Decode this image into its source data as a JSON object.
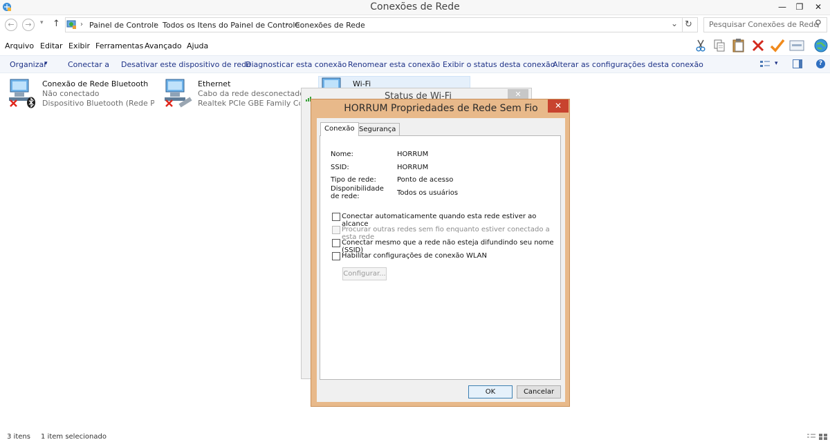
{
  "window": {
    "title": "Conexões de Rede",
    "minimize_glyph": "—",
    "restore_glyph": "❐",
    "close_glyph": "✕"
  },
  "address": {
    "back_glyph": "←",
    "forward_glyph": "→",
    "recent_glyph": "▾",
    "up_glyph": "↑",
    "breadcrumb": [
      "Painel de Controle",
      "Todos os Itens do Painel de Controle",
      "Conexões de Rede"
    ],
    "separator": "›",
    "dropdown_glyph": "⌄",
    "refresh_glyph": "↻",
    "search_placeholder": "Pesquisar Conexões de Rede",
    "search_glyph": "⚲"
  },
  "menu": [
    "Arquivo",
    "Editar",
    "Exibir",
    "Ferramentas",
    "Avançado",
    "Ajuda"
  ],
  "toolbar_icons": [
    "scissors-icon",
    "copy-icon",
    "paste-icon",
    "delete-icon",
    "checkmark-icon",
    "properties-icon",
    "globe-icon"
  ],
  "commands": {
    "organize": "Organizar",
    "organize_arrow": "▾",
    "items": [
      "Conectar a",
      "Desativar este dispositivo de rede",
      "Diagnosticar esta conexão",
      "Renomear esta conexão",
      "Exibir o status desta conexão",
      "Alterar as configurações desta conexão"
    ],
    "view_arrow": "▾",
    "help_glyph": "?"
  },
  "connections": [
    {
      "name": "Conexão de Rede Bluetooth",
      "status": "Não conectado",
      "device": "Dispositivo Bluetooth (Rede Pess..."
    },
    {
      "name": "Ethernet",
      "status": "Cabo da rede desconectado",
      "device": "Realtek PCIe GBE Family Controll..."
    },
    {
      "name": "Wi-Fi"
    }
  ],
  "status_dialog": {
    "title": "Status de Wi-Fi",
    "close_glyph": "✕"
  },
  "properties_dialog": {
    "title": "HORRUM Propriedades de Rede Sem Fio",
    "close_glyph": "✕",
    "tabs": [
      "Conexão",
      "Segurança"
    ],
    "fields": [
      {
        "label": "Nome:",
        "value": "HORRUM"
      },
      {
        "label": "SSID:",
        "value": "HORRUM"
      },
      {
        "label": "Tipo de rede:",
        "value": "Ponto de acesso"
      },
      {
        "label": "Disponibilidade de rede:",
        "value": "Todos os usuários"
      }
    ],
    "options": [
      {
        "text": "Conectar automaticamente quando esta rede estiver ao alcance",
        "checked": false,
        "enabled": true
      },
      {
        "text": "Procurar outras redes sem fio enquanto estiver conectado a esta rede",
        "checked": false,
        "enabled": false
      },
      {
        "text": "Conectar mesmo que a rede não esteja difundindo seu nome (SSID)",
        "checked": false,
        "enabled": true
      },
      {
        "text": "Habilitar configurações de conexão WLAN",
        "checked": false,
        "enabled": true
      }
    ],
    "configure_button": "Configurar...",
    "ok_button": "OK",
    "cancel_button": "Cancelar"
  },
  "statusbar": {
    "item_count": "3 itens",
    "selected": "1 item selecionado"
  }
}
